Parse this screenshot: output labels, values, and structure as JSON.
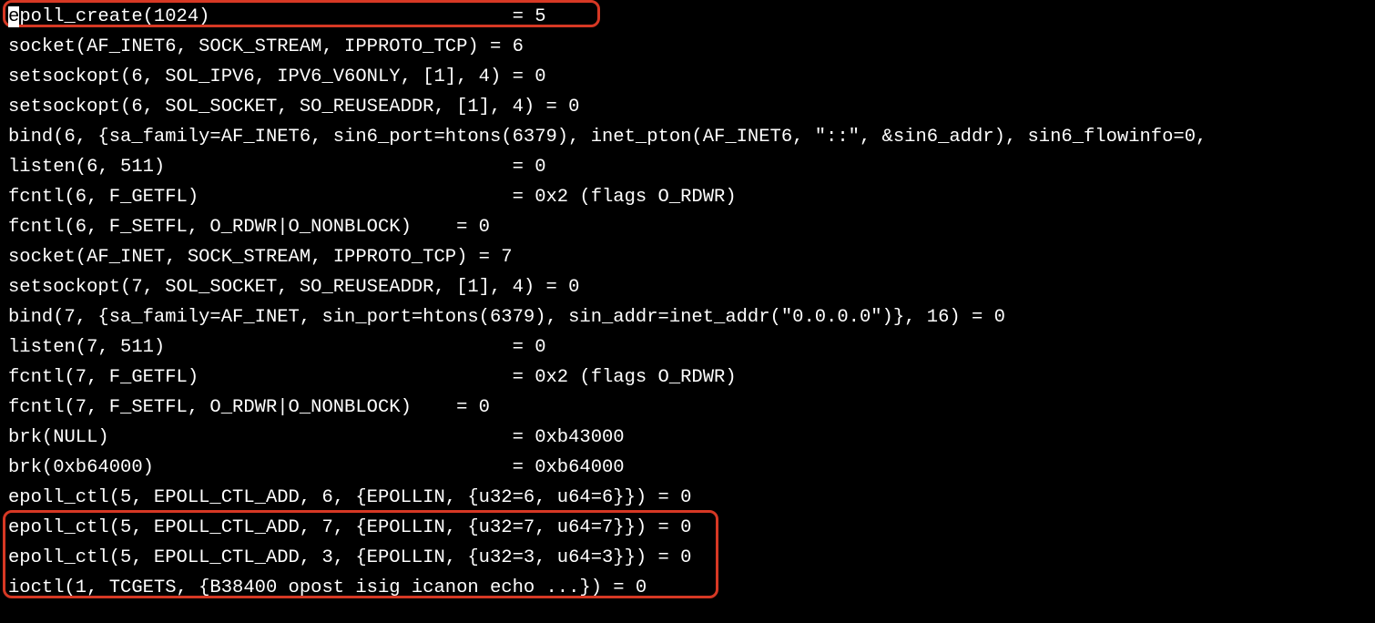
{
  "highlight_color": "#d63824",
  "lines": [
    {
      "sel_head": "e",
      "text": "poll_create(1024)                           = 5"
    },
    {
      "text": "socket(AF_INET6, SOCK_STREAM, IPPROTO_TCP) = 6"
    },
    {
      "text": "setsockopt(6, SOL_IPV6, IPV6_V6ONLY, [1], 4) = 0"
    },
    {
      "text": "setsockopt(6, SOL_SOCKET, SO_REUSEADDR, [1], 4) = 0"
    },
    {
      "text": "bind(6, {sa_family=AF_INET6, sin6_port=htons(6379), inet_pton(AF_INET6, \"::\", &sin6_addr), sin6_flowinfo=0,"
    },
    {
      "text": "listen(6, 511)                               = 0"
    },
    {
      "text": "fcntl(6, F_GETFL)                            = 0x2 (flags O_RDWR)"
    },
    {
      "text": "fcntl(6, F_SETFL, O_RDWR|O_NONBLOCK)    = 0"
    },
    {
      "text": "socket(AF_INET, SOCK_STREAM, IPPROTO_TCP) = 7"
    },
    {
      "text": "setsockopt(7, SOL_SOCKET, SO_REUSEADDR, [1], 4) = 0"
    },
    {
      "text": "bind(7, {sa_family=AF_INET, sin_port=htons(6379), sin_addr=inet_addr(\"0.0.0.0\")}, 16) = 0"
    },
    {
      "text": "listen(7, 511)                               = 0"
    },
    {
      "text": "fcntl(7, F_GETFL)                            = 0x2 (flags O_RDWR)"
    },
    {
      "text": "fcntl(7, F_SETFL, O_RDWR|O_NONBLOCK)    = 0"
    },
    {
      "text": "brk(NULL)                                    = 0xb43000"
    },
    {
      "text": "brk(0xb64000)                                = 0xb64000"
    },
    {
      "text": "epoll_ctl(5, EPOLL_CTL_ADD, 6, {EPOLLIN, {u32=6, u64=6}}) = 0"
    },
    {
      "text": "epoll_ctl(5, EPOLL_CTL_ADD, 7, {EPOLLIN, {u32=7, u64=7}}) = 0"
    },
    {
      "text": "epoll_ctl(5, EPOLL_CTL_ADD, 3, {EPOLLIN, {u32=3, u64=3}}) = 0"
    },
    {
      "text": "ioctl(1, TCGETS, {B38400 opost isig icanon echo ...}) = 0"
    }
  ]
}
